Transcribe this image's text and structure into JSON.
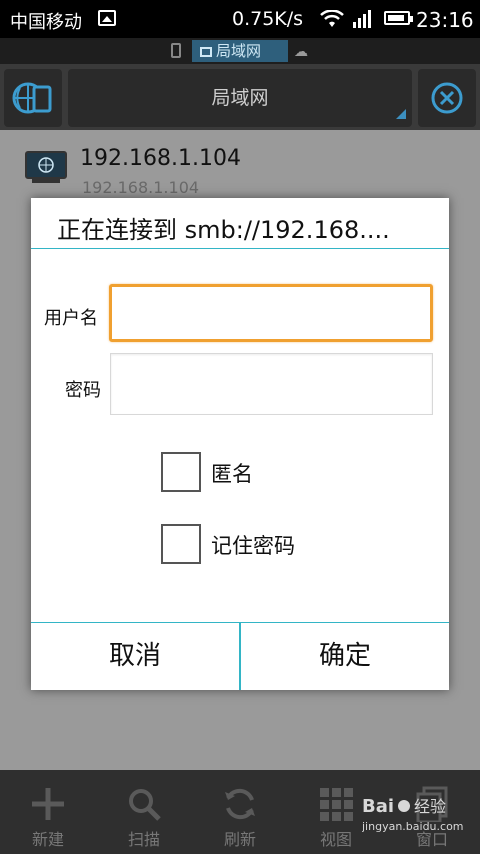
{
  "status_bar": {
    "carrier": "中国移动",
    "network_speed": "0.75K/s",
    "time": "23:16"
  },
  "location_bar": {
    "current": "局域网"
  },
  "toolbar": {
    "title": "局域网"
  },
  "list": {
    "items": [
      {
        "ip": "192.168.1.104",
        "subtitle": "192.168.1.104"
      }
    ]
  },
  "dialog": {
    "title": "正在连接到 smb://192.168....",
    "username_label": "用户名",
    "username_value": "",
    "password_label": "密码",
    "password_value": "",
    "anonymous_label": "匿名",
    "anonymous_checked": false,
    "remember_label": "记住密码",
    "remember_checked": false,
    "cancel_label": "取消",
    "ok_label": "确定"
  },
  "bottom_bar": {
    "items": [
      {
        "label": "新建",
        "icon": "plus-icon"
      },
      {
        "label": "扫描",
        "icon": "magnifier-icon"
      },
      {
        "label": "刷新",
        "icon": "refresh-icon"
      },
      {
        "label": "视图",
        "icon": "grid-view-icon"
      },
      {
        "label": "窗口",
        "icon": "window-icon"
      }
    ]
  },
  "colors": {
    "accent": "#33b5c6",
    "focus": "#f0a030",
    "location_highlight": "#2e5f7c"
  }
}
